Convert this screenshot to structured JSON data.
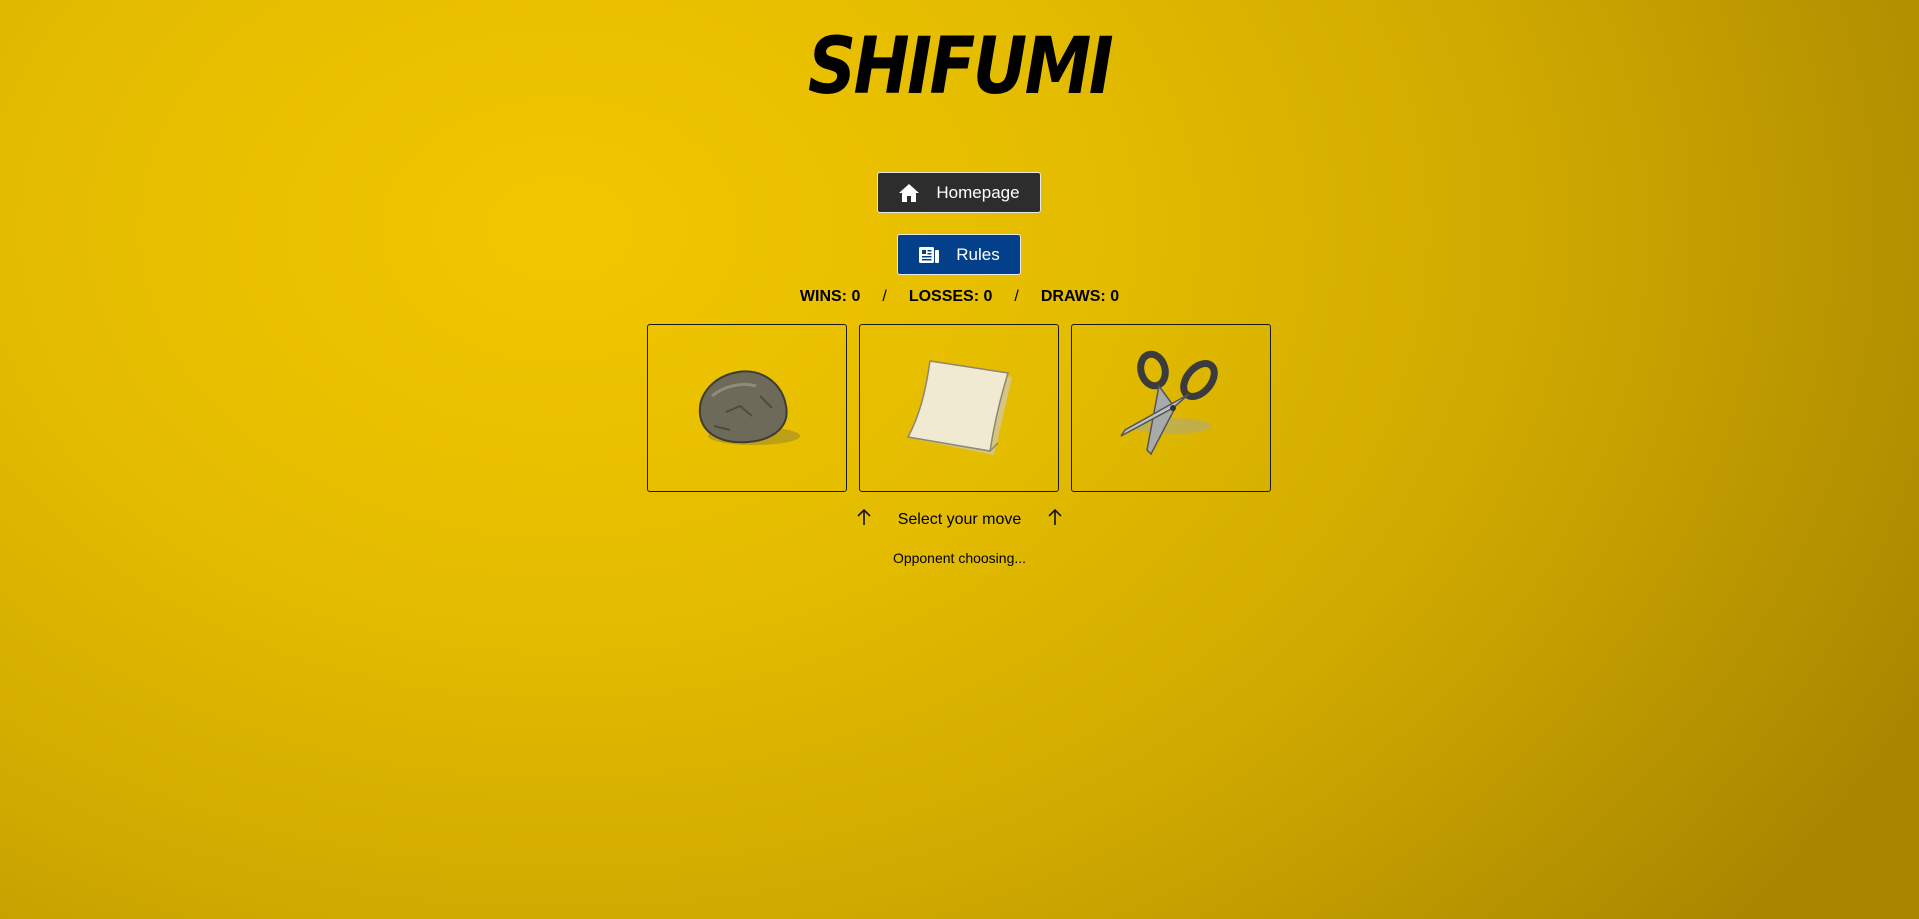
{
  "title": "SHIFUMI",
  "buttons": {
    "homepage_label": "Homepage",
    "rules_label": "Rules"
  },
  "scoreboard": {
    "wins_label": "WINS:",
    "wins": "0",
    "losses_label": "LOSSES:",
    "losses": "0",
    "draws_label": "DRAWS:",
    "draws": "0",
    "separator": "/"
  },
  "moves": [
    {
      "name": "rock",
      "icon": "rock-icon"
    },
    {
      "name": "paper",
      "icon": "paper-icon"
    },
    {
      "name": "scissors",
      "icon": "scissors-icon"
    }
  ],
  "prompt": "Select your move",
  "opponent_status": "Opponent choosing...",
  "colors": {
    "background": "#e4bc00",
    "homepage_button": "#2d2d2d",
    "rules_button": "#04408a"
  }
}
